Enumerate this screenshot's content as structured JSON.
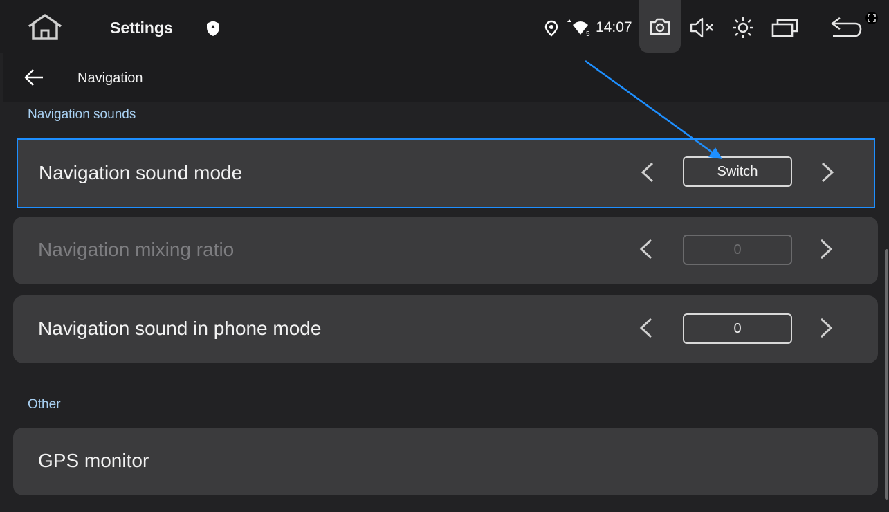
{
  "status_bar": {
    "title": "Settings",
    "time": "14:07",
    "network_badge": "5"
  },
  "sub_header": {
    "title": "Navigation"
  },
  "sections": {
    "nav_sounds": "Navigation sounds",
    "other": "Other"
  },
  "rows": {
    "sound_mode": {
      "label": "Navigation sound mode",
      "value": "Switch"
    },
    "mixing_ratio": {
      "label": "Navigation mixing ratio",
      "value": "0"
    },
    "phone_mode": {
      "label": "Navigation sound in phone mode",
      "value": "0"
    },
    "gps": {
      "label": "GPS monitor"
    }
  },
  "icons": {
    "home": "home-icon",
    "shield": "shield-icon",
    "location": "location-pin-icon",
    "wifi": "wifi-icon",
    "camera": "camera-icon",
    "mute": "volume-mute-icon",
    "brightness": "brightness-icon",
    "windows": "multi-window-icon",
    "back": "back-icon",
    "fullscreen": "fullscreen-icon"
  },
  "colors": {
    "accent": "#1e8fff",
    "section_header": "#a8d0f2",
    "background": "#222224",
    "row_bg": "#3b3b3d"
  }
}
